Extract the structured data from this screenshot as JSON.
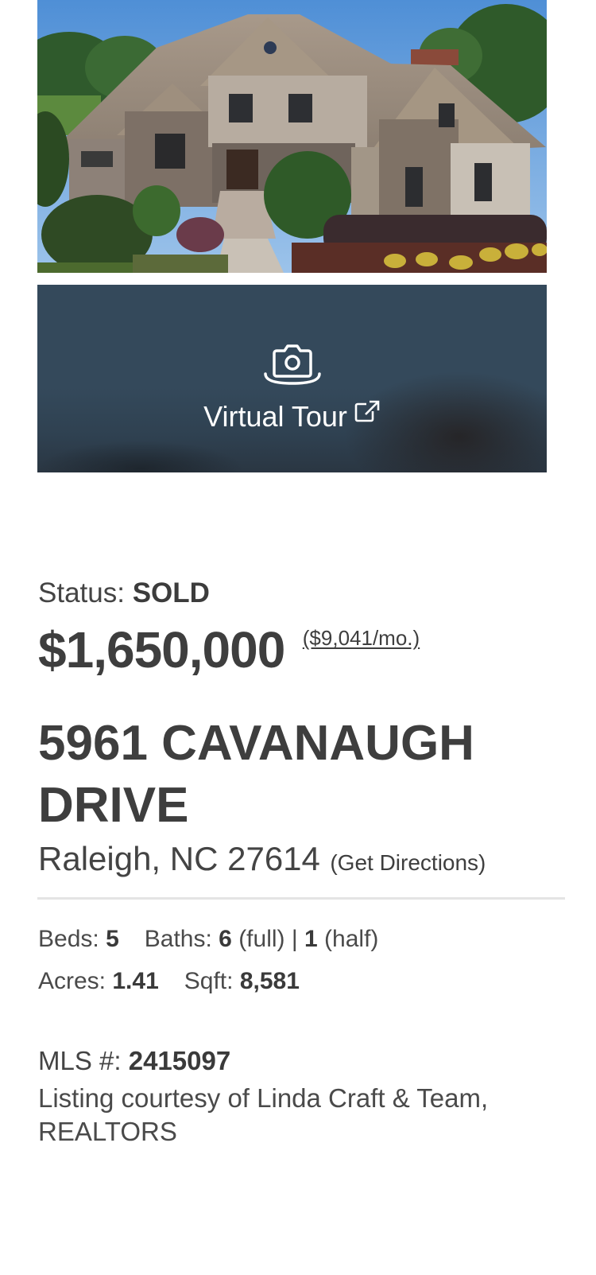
{
  "listing": {
    "photo_icon": "house-photo",
    "virtual_tour": {
      "label": "Virtual Tour",
      "camera_icon": "camera-icon",
      "external_icon": "external-link-icon"
    },
    "status_label": "Status:",
    "status_value": "SOLD",
    "price": "$1,650,000",
    "monthly_payment": "($9,041/mo.)",
    "address_line1": "5961 CAVANAUGH DRIVE",
    "city_state_zip": "Raleigh, NC 27614",
    "directions_link": "(Get Directions)",
    "facts": {
      "beds_label": "Beds:",
      "beds_value": "5",
      "baths_label": "Baths:",
      "baths_full_value": "6",
      "baths_full_suffix": "(full)",
      "baths_separator": "|",
      "baths_half_value": "1",
      "baths_half_suffix": "(half)",
      "acres_label": "Acres:",
      "acres_value": "1.41",
      "sqft_label": "Sqft:",
      "sqft_value": "8,581"
    },
    "mls_label": "MLS #:",
    "mls_value": "2415097",
    "courtesy": "Listing courtesy of Linda Craft & Team, REALTORS"
  },
  "colors": {
    "tour_panel": "#34495b",
    "text": "#3e3e3e",
    "divider": "#e4e4e4"
  }
}
